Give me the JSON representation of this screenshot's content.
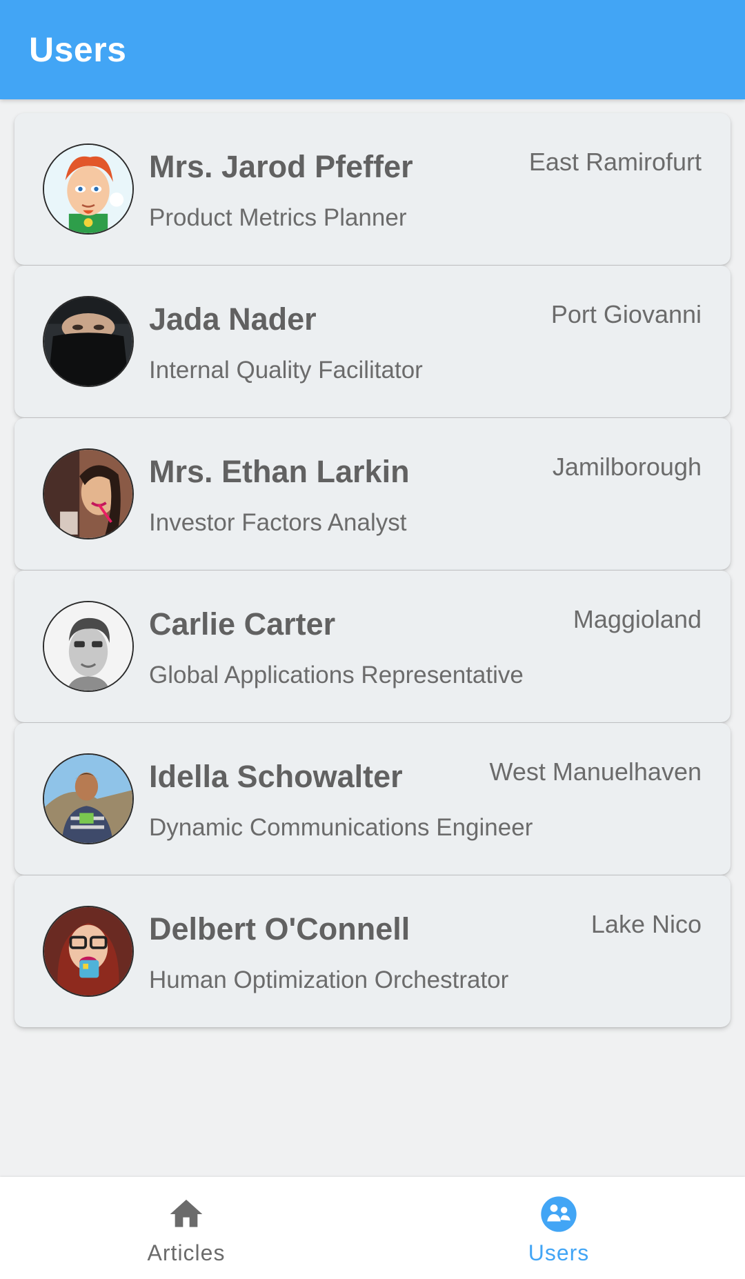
{
  "appbar": {
    "title": "Users"
  },
  "colors": {
    "primary": "#42a5f5",
    "card": "#eceff1",
    "inactive": "#6b6b6b"
  },
  "users": [
    {
      "name": "Mrs. Jarod Pfeffer",
      "title": "Product Metrics Planner",
      "city": "East Ramirofurt",
      "avatar": "cartoon-avatar"
    },
    {
      "name": "Jada Nader",
      "title": "Internal Quality Facilitator",
      "city": "Port Giovanni",
      "avatar": "masked-face-avatar"
    },
    {
      "name": "Mrs. Ethan Larkin",
      "title": "Investor Factors Analyst",
      "city": "Jamilborough",
      "avatar": "woman-photo-avatar"
    },
    {
      "name": "Carlie Carter",
      "title": "Global Applications Representative",
      "city": "Maggioland",
      "avatar": "man-bw-photo-avatar"
    },
    {
      "name": "Idella Schowalter",
      "title": "Dynamic Communications Engineer",
      "city": "West Manuelhaven",
      "avatar": "man-outdoor-photo-avatar"
    },
    {
      "name": "Delbert O'Connell",
      "title": "Human Optimization Orchestrator",
      "city": "Lake Nico",
      "avatar": "woman-glasses-photo-avatar"
    }
  ],
  "bottom_nav": {
    "items": [
      {
        "label": "Articles",
        "icon": "home-icon",
        "active": false
      },
      {
        "label": "Users",
        "icon": "users-icon",
        "active": true
      }
    ]
  }
}
